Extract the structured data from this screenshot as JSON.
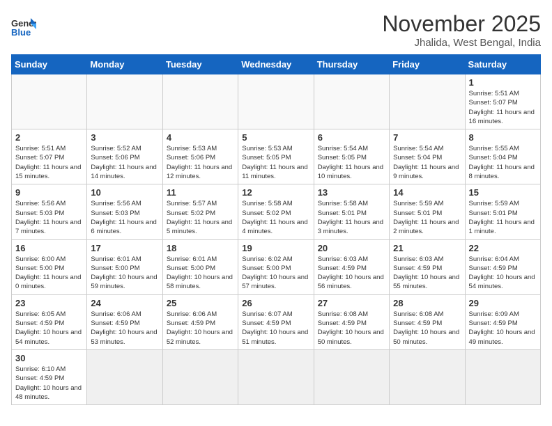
{
  "logo": {
    "text_general": "General",
    "text_blue": "Blue"
  },
  "header": {
    "month_year": "November 2025",
    "location": "Jhalida, West Bengal, India"
  },
  "weekdays": [
    "Sunday",
    "Monday",
    "Tuesday",
    "Wednesday",
    "Thursday",
    "Friday",
    "Saturday"
  ],
  "weeks": [
    [
      {
        "day": "",
        "info": ""
      },
      {
        "day": "",
        "info": ""
      },
      {
        "day": "",
        "info": ""
      },
      {
        "day": "",
        "info": ""
      },
      {
        "day": "",
        "info": ""
      },
      {
        "day": "",
        "info": ""
      },
      {
        "day": "1",
        "info": "Sunrise: 5:51 AM\nSunset: 5:07 PM\nDaylight: 11 hours and 16 minutes."
      }
    ],
    [
      {
        "day": "2",
        "info": "Sunrise: 5:51 AM\nSunset: 5:07 PM\nDaylight: 11 hours and 15 minutes."
      },
      {
        "day": "3",
        "info": "Sunrise: 5:52 AM\nSunset: 5:06 PM\nDaylight: 11 hours and 14 minutes."
      },
      {
        "day": "4",
        "info": "Sunrise: 5:53 AM\nSunset: 5:06 PM\nDaylight: 11 hours and 12 minutes."
      },
      {
        "day": "5",
        "info": "Sunrise: 5:53 AM\nSunset: 5:05 PM\nDaylight: 11 hours and 11 minutes."
      },
      {
        "day": "6",
        "info": "Sunrise: 5:54 AM\nSunset: 5:05 PM\nDaylight: 11 hours and 10 minutes."
      },
      {
        "day": "7",
        "info": "Sunrise: 5:54 AM\nSunset: 5:04 PM\nDaylight: 11 hours and 9 minutes."
      },
      {
        "day": "8",
        "info": "Sunrise: 5:55 AM\nSunset: 5:04 PM\nDaylight: 11 hours and 8 minutes."
      }
    ],
    [
      {
        "day": "9",
        "info": "Sunrise: 5:56 AM\nSunset: 5:03 PM\nDaylight: 11 hours and 7 minutes."
      },
      {
        "day": "10",
        "info": "Sunrise: 5:56 AM\nSunset: 5:03 PM\nDaylight: 11 hours and 6 minutes."
      },
      {
        "day": "11",
        "info": "Sunrise: 5:57 AM\nSunset: 5:02 PM\nDaylight: 11 hours and 5 minutes."
      },
      {
        "day": "12",
        "info": "Sunrise: 5:58 AM\nSunset: 5:02 PM\nDaylight: 11 hours and 4 minutes."
      },
      {
        "day": "13",
        "info": "Sunrise: 5:58 AM\nSunset: 5:01 PM\nDaylight: 11 hours and 3 minutes."
      },
      {
        "day": "14",
        "info": "Sunrise: 5:59 AM\nSunset: 5:01 PM\nDaylight: 11 hours and 2 minutes."
      },
      {
        "day": "15",
        "info": "Sunrise: 5:59 AM\nSunset: 5:01 PM\nDaylight: 11 hours and 1 minute."
      }
    ],
    [
      {
        "day": "16",
        "info": "Sunrise: 6:00 AM\nSunset: 5:00 PM\nDaylight: 11 hours and 0 minutes."
      },
      {
        "day": "17",
        "info": "Sunrise: 6:01 AM\nSunset: 5:00 PM\nDaylight: 10 hours and 59 minutes."
      },
      {
        "day": "18",
        "info": "Sunrise: 6:01 AM\nSunset: 5:00 PM\nDaylight: 10 hours and 58 minutes."
      },
      {
        "day": "19",
        "info": "Sunrise: 6:02 AM\nSunset: 5:00 PM\nDaylight: 10 hours and 57 minutes."
      },
      {
        "day": "20",
        "info": "Sunrise: 6:03 AM\nSunset: 4:59 PM\nDaylight: 10 hours and 56 minutes."
      },
      {
        "day": "21",
        "info": "Sunrise: 6:03 AM\nSunset: 4:59 PM\nDaylight: 10 hours and 55 minutes."
      },
      {
        "day": "22",
        "info": "Sunrise: 6:04 AM\nSunset: 4:59 PM\nDaylight: 10 hours and 54 minutes."
      }
    ],
    [
      {
        "day": "23",
        "info": "Sunrise: 6:05 AM\nSunset: 4:59 PM\nDaylight: 10 hours and 54 minutes."
      },
      {
        "day": "24",
        "info": "Sunrise: 6:06 AM\nSunset: 4:59 PM\nDaylight: 10 hours and 53 minutes."
      },
      {
        "day": "25",
        "info": "Sunrise: 6:06 AM\nSunset: 4:59 PM\nDaylight: 10 hours and 52 minutes."
      },
      {
        "day": "26",
        "info": "Sunrise: 6:07 AM\nSunset: 4:59 PM\nDaylight: 10 hours and 51 minutes."
      },
      {
        "day": "27",
        "info": "Sunrise: 6:08 AM\nSunset: 4:59 PM\nDaylight: 10 hours and 50 minutes."
      },
      {
        "day": "28",
        "info": "Sunrise: 6:08 AM\nSunset: 4:59 PM\nDaylight: 10 hours and 50 minutes."
      },
      {
        "day": "29",
        "info": "Sunrise: 6:09 AM\nSunset: 4:59 PM\nDaylight: 10 hours and 49 minutes."
      }
    ],
    [
      {
        "day": "30",
        "info": "Sunrise: 6:10 AM\nSunset: 4:59 PM\nDaylight: 10 hours and 48 minutes."
      },
      {
        "day": "",
        "info": ""
      },
      {
        "day": "",
        "info": ""
      },
      {
        "day": "",
        "info": ""
      },
      {
        "day": "",
        "info": ""
      },
      {
        "day": "",
        "info": ""
      },
      {
        "day": "",
        "info": ""
      }
    ]
  ]
}
